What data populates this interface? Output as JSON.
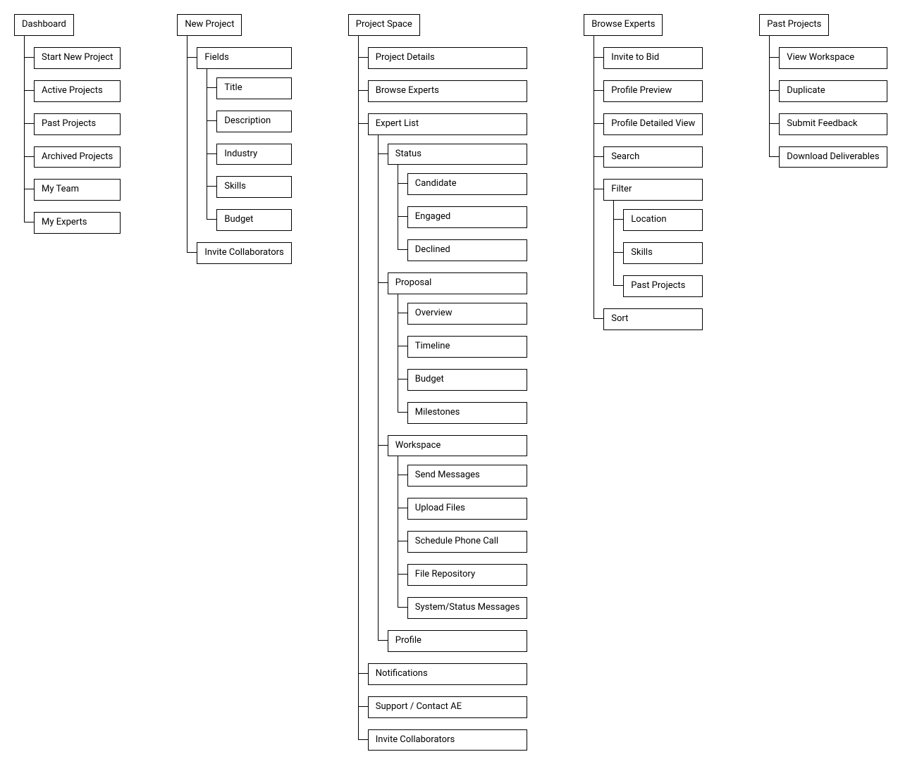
{
  "columns": [
    {
      "id": "dashboard",
      "label": "Dashboard",
      "children": [
        {
          "id": "start-new-project",
          "label": "Start New Project"
        },
        {
          "id": "active-projects",
          "label": "Active Projects"
        },
        {
          "id": "past-projects",
          "label": "Past Projects"
        },
        {
          "id": "archived-projects",
          "label": "Archived Projects"
        },
        {
          "id": "my-team",
          "label": "My Team"
        },
        {
          "id": "my-experts",
          "label": "My Experts"
        }
      ]
    },
    {
      "id": "new-project",
      "label": "New Project",
      "children": [
        {
          "id": "fields",
          "label": "Fields",
          "children": [
            {
              "id": "field-title",
              "label": "Title"
            },
            {
              "id": "field-description",
              "label": "Description"
            },
            {
              "id": "field-industry",
              "label": "Industry"
            },
            {
              "id": "field-skills",
              "label": "Skills"
            },
            {
              "id": "field-budget",
              "label": "Budget"
            }
          ]
        },
        {
          "id": "invite-collaborators",
          "label": "Invite Collaborators"
        }
      ]
    },
    {
      "id": "project-space",
      "label": "Project Space",
      "children": [
        {
          "id": "project-details",
          "label": "Project Details"
        },
        {
          "id": "browse-experts-ps",
          "label": "Browse Experts"
        },
        {
          "id": "expert-list",
          "label": "Expert List",
          "children": [
            {
              "id": "status",
              "label": "Status",
              "children": [
                {
                  "id": "status-candidate",
                  "label": "Candidate"
                },
                {
                  "id": "status-engaged",
                  "label": "Engaged"
                },
                {
                  "id": "status-declined",
                  "label": "Declined"
                }
              ]
            },
            {
              "id": "proposal",
              "label": "Proposal",
              "children": [
                {
                  "id": "proposal-overview",
                  "label": "Overview"
                },
                {
                  "id": "proposal-timeline",
                  "label": "Timeline"
                },
                {
                  "id": "proposal-budget",
                  "label": "Budget"
                },
                {
                  "id": "proposal-milestones",
                  "label": "Milestones"
                }
              ]
            },
            {
              "id": "workspace",
              "label": "Workspace",
              "children": [
                {
                  "id": "ws-send-messages",
                  "label": "Send Messages"
                },
                {
                  "id": "ws-upload-files",
                  "label": "Upload Files"
                },
                {
                  "id": "ws-schedule-call",
                  "label": "Schedule Phone Call"
                },
                {
                  "id": "ws-file-repo",
                  "label": "File Repository"
                },
                {
                  "id": "ws-system-status",
                  "label": "System/Status Messages"
                }
              ]
            },
            {
              "id": "profile",
              "label": "Profile"
            }
          ]
        },
        {
          "id": "notifications",
          "label": "Notifications"
        },
        {
          "id": "support-contact-ae",
          "label": "Support / Contact AE"
        },
        {
          "id": "invite-collaborators-ps",
          "label": "Invite Collaborators"
        }
      ]
    },
    {
      "id": "browse-experts",
      "label": "Browse Experts",
      "children": [
        {
          "id": "invite-to-bid",
          "label": "Invite to Bid"
        },
        {
          "id": "profile-preview",
          "label": "Profile Preview"
        },
        {
          "id": "profile-detailed",
          "label": "Profile Detailed View"
        },
        {
          "id": "search",
          "label": "Search"
        },
        {
          "id": "filter",
          "label": "Filter",
          "children": [
            {
              "id": "filter-location",
              "label": "Location"
            },
            {
              "id": "filter-skills",
              "label": "Skills"
            },
            {
              "id": "filter-past-projects",
              "label": "Past Projects"
            }
          ]
        },
        {
          "id": "sort",
          "label": "Sort"
        }
      ]
    },
    {
      "id": "past-projects-root",
      "label": "Past Projects",
      "children": [
        {
          "id": "view-workspace",
          "label": "View Workspace"
        },
        {
          "id": "duplicate",
          "label": "Duplicate"
        },
        {
          "id": "submit-feedback",
          "label": "Submit Feedback"
        },
        {
          "id": "download-deliverables",
          "label": "Download Deliverables"
        }
      ]
    }
  ]
}
